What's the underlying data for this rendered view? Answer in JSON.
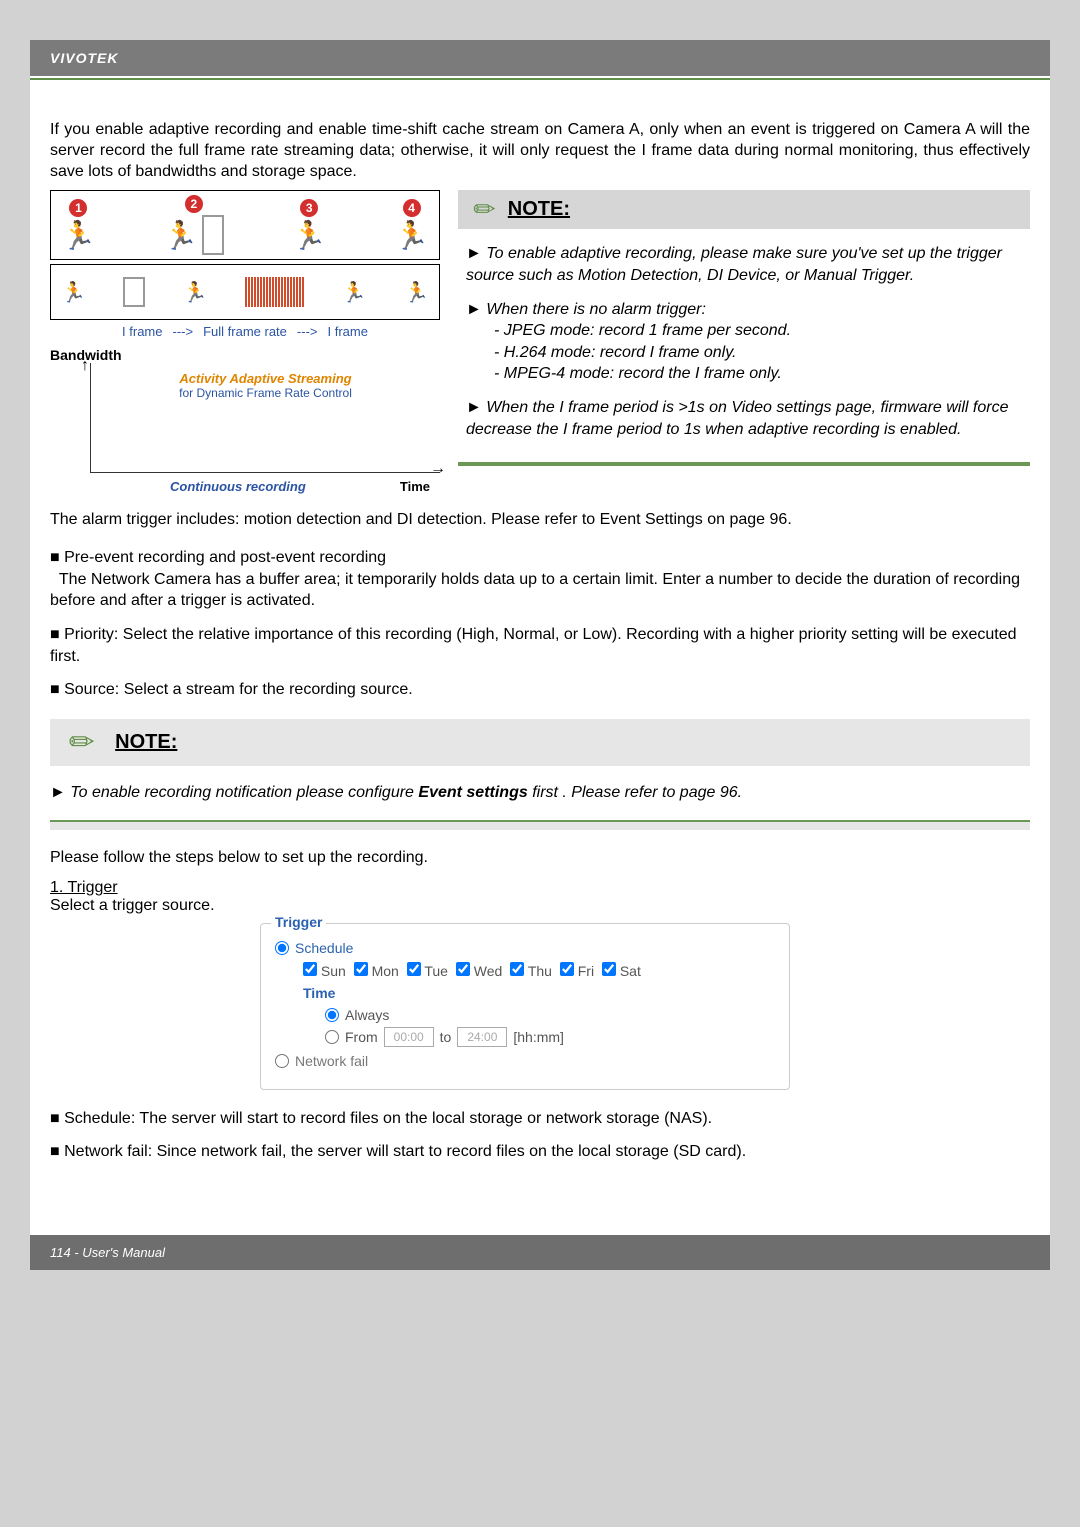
{
  "header": {
    "brand": "VIVOTEK"
  },
  "intro": "If you enable adaptive recording and enable time-shift cache stream on Camera A, only when an event is triggered on Camera A will the server record the full frame rate streaming data; otherwise, it will only request the I frame data during normal monitoring, thus effectively save lots of bandwidths and storage space.",
  "diagram": {
    "frame_labels": {
      "left": "I frame",
      "arrow1": "--->",
      "mid": "Full frame rate",
      "arrow2": "--->",
      "right": "I frame"
    },
    "bandwidth": "Bandwidth",
    "aas": "Activity Adaptive Streaming",
    "dfrc": "for Dynamic Frame Rate Control",
    "cont": "Continuous recording",
    "time": "Time",
    "chips": [
      "1",
      "2",
      "3",
      "4"
    ]
  },
  "note1": {
    "title": "NOTE:",
    "items": [
      "To enable adaptive recording, please make sure you've set up the trigger source such as Motion Detection, DI Device, or Manual Trigger.",
      "When there is no alarm trigger:",
      "When the I frame period is >1s on Video settings page, firmware will force decrease the I frame period to 1s when adaptive recording is enabled."
    ],
    "subitems": [
      "- JPEG mode: record 1 frame per second.",
      "- H.264 mode: record I frame only.",
      "- MPEG-4 mode: record the I frame only."
    ]
  },
  "alarm_line": "The alarm trigger includes: motion detection and DI detection. Please refer to Event Settings on page 96.",
  "bullets": {
    "pre_title": "Pre-event recording and post-event recording",
    "pre_body": "The Network Camera has a buffer area; it temporarily holds data up to a certain limit. Enter a number to decide the duration of recording before and after a trigger is activated.",
    "priority": "Priority: Select the relative importance of this recording (High, Normal, or Low). Recording with a higher priority setting will be executed first.",
    "source": "Source: Select a stream for the recording source."
  },
  "note2": {
    "title": "NOTE:",
    "pre": "To enable recording notification please configure ",
    "bold": "Event settings",
    "post": " first . Please refer to page 96."
  },
  "steps_intro": "Please follow the steps below to set up the recording.",
  "step1": {
    "heading": "1. Trigger",
    "sub": "Select a trigger source."
  },
  "ui": {
    "legend": "Trigger",
    "schedule": "Schedule",
    "days": [
      "Sun",
      "Mon",
      "Tue",
      "Wed",
      "Thu",
      "Fri",
      "Sat"
    ],
    "time_label": "Time",
    "always": "Always",
    "from": "From",
    "from_val": "00:00",
    "to": "to",
    "to_val": "24:00",
    "hhmm": "[hh:mm]",
    "network_fail": "Network fail"
  },
  "tail": {
    "schedule": "Schedule: The server will start to record files on the local storage or network storage (NAS).",
    "network": "Network fail: Since network fail, the server will start to record files on the local storage (SD card)."
  },
  "footer": "114 - User's Manual"
}
